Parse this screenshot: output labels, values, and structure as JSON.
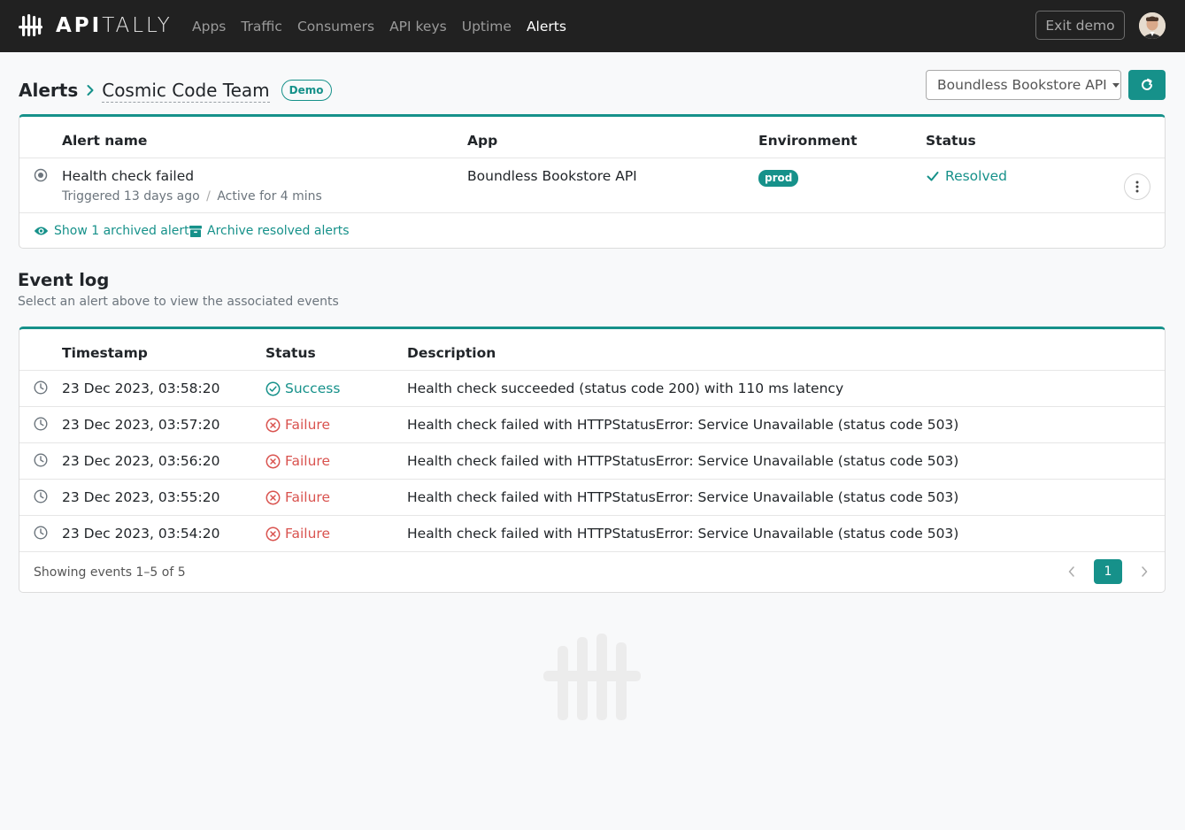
{
  "nav": {
    "brand_bold": "API",
    "brand_light": "TALLY",
    "links": [
      "Apps",
      "Traffic",
      "Consumers",
      "API keys",
      "Uptime",
      "Alerts"
    ],
    "active_link": "Alerts",
    "exit_label": "Exit demo"
  },
  "header": {
    "root": "Alerts",
    "team": "Cosmic Code Team",
    "badge": "Demo",
    "app_select": "Boundless Bookstore API"
  },
  "alerts": {
    "columns": [
      "Alert name",
      "App",
      "Environment",
      "Status"
    ],
    "rows": [
      {
        "name": "Health check failed",
        "triggered": "Triggered 13 days ago",
        "separator": "/",
        "active": "Active for 4 mins",
        "app": "Boundless Bookstore API",
        "environment": "prod",
        "status": "Resolved"
      }
    ],
    "show_archived": "Show 1 archived alert",
    "archive_resolved": "Archive resolved alerts"
  },
  "event_log": {
    "title": "Event log",
    "subtitle": "Select an alert above to view the associated events",
    "columns": [
      "Timestamp",
      "Status",
      "Description"
    ],
    "rows": [
      {
        "timestamp": "23 Dec 2023, 03:58:20",
        "status": "Success",
        "description": "Health check succeeded (status code 200) with 110 ms latency"
      },
      {
        "timestamp": "23 Dec 2023, 03:57:20",
        "status": "Failure",
        "description": "Health check failed with HTTPStatusError: Service Unavailable (status code 503)"
      },
      {
        "timestamp": "23 Dec 2023, 03:56:20",
        "status": "Failure",
        "description": "Health check failed with HTTPStatusError: Service Unavailable (status code 503)"
      },
      {
        "timestamp": "23 Dec 2023, 03:55:20",
        "status": "Failure",
        "description": "Health check failed with HTTPStatusError: Service Unavailable (status code 503)"
      },
      {
        "timestamp": "23 Dec 2023, 03:54:20",
        "status": "Failure",
        "description": "Health check failed with HTTPStatusError: Service Unavailable (status code 503)"
      }
    ],
    "footer": "Showing events 1–5 of 5",
    "current_page": "1"
  },
  "colors": {
    "accent": "#16918a",
    "failure": "#d9534f",
    "navbar": "#212121"
  }
}
